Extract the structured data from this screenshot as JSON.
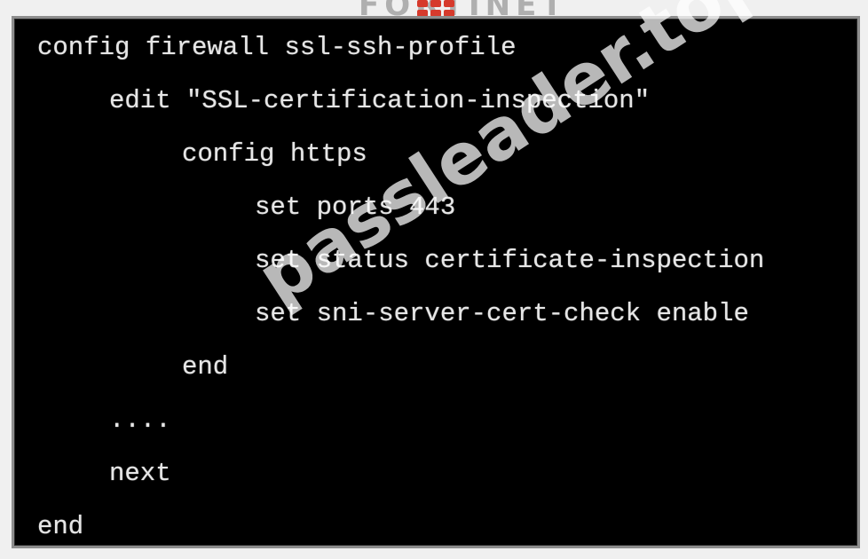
{
  "logo": {
    "text": "FORTINET"
  },
  "terminal": {
    "lines": [
      "config firewall ssl-ssh-profile",
      "edit \"SSL-certification-inspection\"",
      "config https",
      "set ports 443",
      "set status certificate-inspection",
      "set sni-server-cert-check enable",
      "end",
      "....",
      "next",
      "end"
    ]
  },
  "watermark": {
    "text": "passleader.top"
  },
  "colors": {
    "terminal_background": "#000000",
    "terminal_text": "#e6e6e6",
    "frame_border": "#8d8d8d",
    "logo_red": "#d63a2c"
  }
}
